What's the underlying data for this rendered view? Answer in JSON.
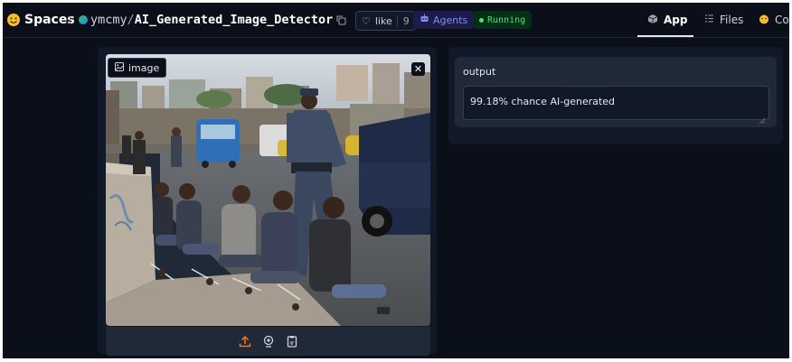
{
  "header": {
    "spaces_label": "Spaces",
    "repo_owner": "ymcmy",
    "repo_slash": "/",
    "repo_name": "AI_Generated_Image_Detector",
    "like_label": "like",
    "like_count": "9",
    "agents_label": "Agents",
    "status_label": "Running",
    "tabs": [
      {
        "label": "App",
        "icon": "cube-icon",
        "active": true
      },
      {
        "label": "Files",
        "icon": "files-icon",
        "active": false
      },
      {
        "label": "Co",
        "icon": "community-icon",
        "active": false
      }
    ]
  },
  "input": {
    "label": "image",
    "image_description_icon": "image-icon",
    "toolbar_icons": [
      "upload-icon",
      "webcam-icon",
      "clipboard-icon"
    ]
  },
  "output": {
    "label": "output",
    "value": "99.18% chance AI-generated"
  },
  "colors": {
    "background": "#0b0f19",
    "panel": "#111827",
    "card": "#1f2937",
    "accent_orange": "#f97316",
    "running_green": "#4ade80",
    "agents_indigo": "#818cf8"
  }
}
